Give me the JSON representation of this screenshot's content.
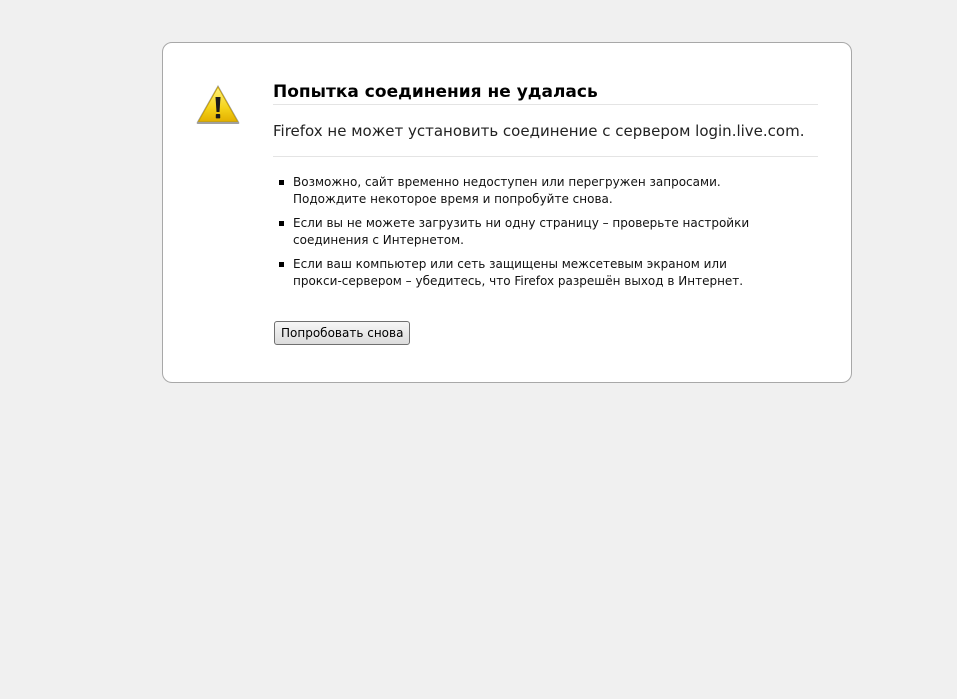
{
  "error": {
    "title": "Попытка соединения не удалась",
    "short_description": "Firefox не может установить соединение с сервером login.live.com.",
    "tips": [
      "Возможно, сайт временно недоступен или перегружен запросами. Подождите некоторое время и попробуйте снова.",
      "Если вы не можете загрузить ни одну страницу – проверьте настройки соединения с Интернетом.",
      "Если ваш компьютер или сеть защищены межсетевым экраном или прокси-сервером – убедитесь, что Firefox разрешён выход в Интернет."
    ],
    "retry_label": "Попробовать снова",
    "icon": "warning-triangle-icon"
  },
  "colors": {
    "page_background": "#f0f0f0",
    "box_background": "#ffffff",
    "box_border": "#a8a8a8",
    "warning_yellow": "#f5d31a"
  }
}
